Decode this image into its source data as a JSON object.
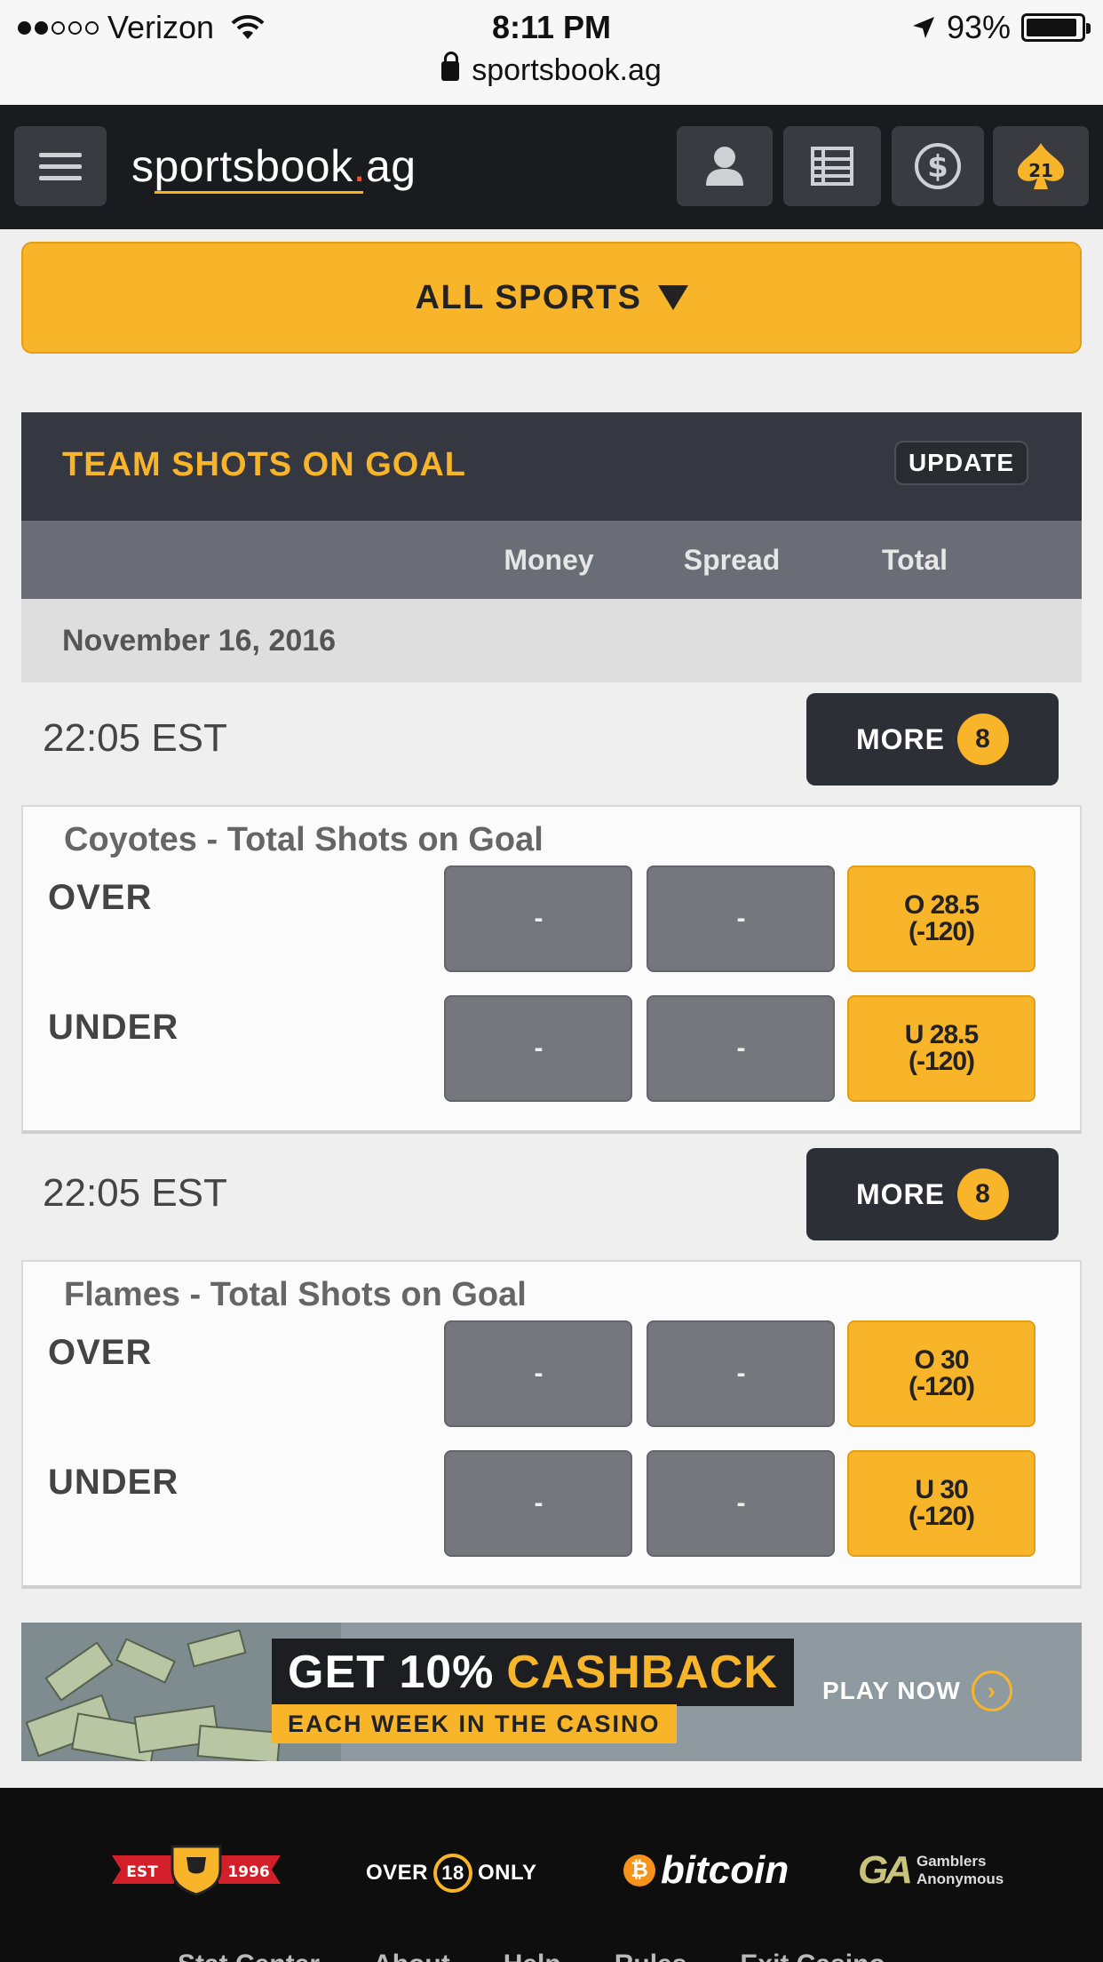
{
  "status_bar": {
    "carrier": "Verizon",
    "time": "8:11 PM",
    "battery": "93%"
  },
  "browser": {
    "url": "sportsbook.ag"
  },
  "header": {
    "logo_main": "sportsbook",
    "logo_dot": ".",
    "logo_ext": "ag",
    "casino_badge": "21"
  },
  "sports_menu": {
    "label": "ALL SPORTS"
  },
  "panel": {
    "title": "TEAM SHOTS ON GOAL",
    "update_label": "UPDATE",
    "columns": [
      "Money",
      "Spread",
      "Total"
    ],
    "date": "November 16, 2016"
  },
  "games": [
    {
      "time": "22:05 EST",
      "more_label": "MORE",
      "more_count": "8",
      "title": "Coyotes - Total Shots on Goal",
      "rows": [
        {
          "label": "OVER",
          "money": "-",
          "spread": "-",
          "total_line": "O 28.5",
          "total_odds": "(-120)"
        },
        {
          "label": "UNDER",
          "money": "-",
          "spread": "-",
          "total_line": "U 28.5",
          "total_odds": "(-120)"
        }
      ]
    },
    {
      "time": "22:05 EST",
      "more_label": "MORE",
      "more_count": "8",
      "title": "Flames - Total Shots on Goal",
      "rows": [
        {
          "label": "OVER",
          "money": "-",
          "spread": "-",
          "total_line": "O 30",
          "total_odds": "(-120)"
        },
        {
          "label": "UNDER",
          "money": "-",
          "spread": "-",
          "total_line": "U 30",
          "total_odds": "(-120)"
        }
      ]
    }
  ],
  "promo": {
    "headline": "GET 10%",
    "headline_highlight": "CASHBACK",
    "subline": "EACH WEEK IN THE CASINO",
    "cta": "PLAY NOW"
  },
  "footer": {
    "est_left": "EST",
    "est_right": "1996",
    "age_prefix": "OVER",
    "age_number": "18",
    "age_suffix": "ONLY",
    "bitcoin": "bitcoin",
    "ga_logo": "GA",
    "ga_line1": "Gamblers",
    "ga_line2": "Anonymous",
    "links": [
      "Stat Center",
      "About",
      "Help",
      "Rules",
      "Exit Casino"
    ]
  },
  "colors": {
    "accent": "#f9b52a",
    "header_bg": "#1a1b1f",
    "panel_bg": "#363841",
    "odds_grey": "#75777d"
  }
}
